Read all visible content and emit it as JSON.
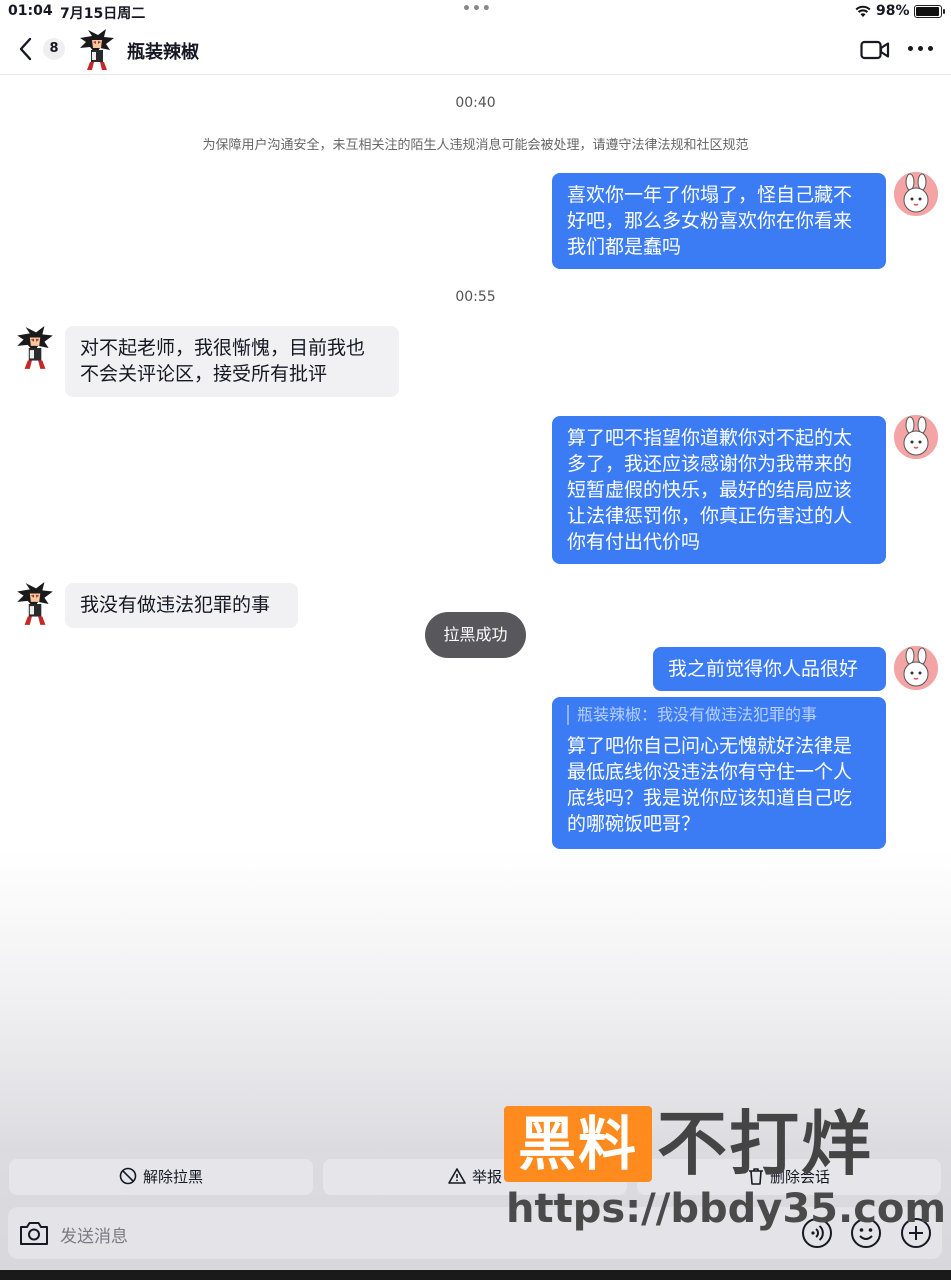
{
  "status_bar": {
    "time": "01:04",
    "date": "7月15日周二",
    "battery": "98%"
  },
  "header": {
    "back_count": "8",
    "title": "瓶装辣椒"
  },
  "conversation": {
    "time_1": "00:40",
    "notice": "为保障用户沟通安全，未互相关注的陌生人违规消息可能会被处理，请遵守法律法规和社区规范",
    "msg_me_1": [
      "喜欢你一年了你塌了，怪自己藏不",
      "好吧，那么多女粉喜欢你在你看来",
      "我们都是蠢吗"
    ],
    "time_2": "00:55",
    "msg_other_1": [
      "对不起老师，我很惭愧，目前我也",
      "不会关评论区，接受所有批评"
    ],
    "msg_me_2": [
      "算了吧不指望你道歉你对不起的太",
      "多了，我还应该感谢你为我带来的",
      "短暂虚假的快乐，最好的结局应该",
      "让法律惩罚你，你真正伤害过的人",
      "你有付出代价吗"
    ],
    "msg_other_2": "我没有做违法犯罪的事",
    "toast": "拉黑成功",
    "msg_me_3": "我之前觉得你人品很好",
    "msg_me_4_quote": "瓶装辣椒：我没有做违法犯罪的事",
    "msg_me_4": [
      "算了吧你自己问心无愧就好法律是",
      "最低底线你没违法你有守住一个人",
      "底线吗？我是说你应该知道自己吃",
      "的哪碗饭吧哥？"
    ]
  },
  "actions": {
    "unblock": "解除拉黑",
    "report": "举报",
    "delete": "删除会话"
  },
  "input": {
    "placeholder": "发送消息"
  },
  "watermark": {
    "box": "黑料",
    "text": "不打烊",
    "url": "https://bbdy35.com"
  },
  "colors": {
    "my_bubble": "#3b7cf5",
    "other_bubble": "#f1f1f3",
    "watermark_orange": "#ff8a1e"
  }
}
